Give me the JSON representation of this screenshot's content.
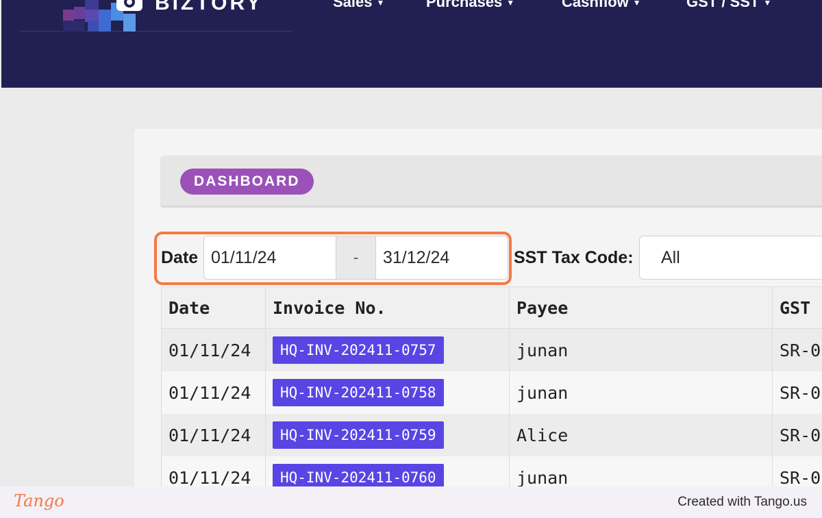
{
  "header": {
    "brand": "BIZTORY",
    "nav": [
      {
        "label": "Sales"
      },
      {
        "label": "Purchases"
      },
      {
        "label": "Cashflow"
      },
      {
        "label": "GST / SST"
      }
    ],
    "colors": {
      "background": "#222052"
    }
  },
  "page": {
    "section_badge": "DASHBOARD"
  },
  "filters": {
    "date_label": "Date",
    "date_from": "01/11/24",
    "date_separator": "-",
    "date_to": "31/12/24",
    "tax_code_label": "SST Tax Code:",
    "tax_code_value": "All"
  },
  "table": {
    "columns": [
      "Date",
      "Invoice No.",
      "Payee",
      "GST"
    ],
    "rows": [
      {
        "date": "01/11/24",
        "invoice": "HQ-INV-202411-0757",
        "payee": "junan",
        "gst": "SR-0"
      },
      {
        "date": "01/11/24",
        "invoice": "HQ-INV-202411-0758",
        "payee": "junan",
        "gst": "SR-0"
      },
      {
        "date": "01/11/24",
        "invoice": "HQ-INV-202411-0759",
        "payee": "Alice",
        "gst": "SR-0"
      },
      {
        "date": "01/11/24",
        "invoice": "HQ-INV-202411-0760",
        "payee": "junan",
        "gst": "SR-0"
      }
    ]
  },
  "footer": {
    "logo": "Tango",
    "text": "Created with Tango.us"
  },
  "colors": {
    "accent_highlight": "#f27a47",
    "badge": "#9b51b8",
    "invoice_badge": "#5945e4"
  }
}
